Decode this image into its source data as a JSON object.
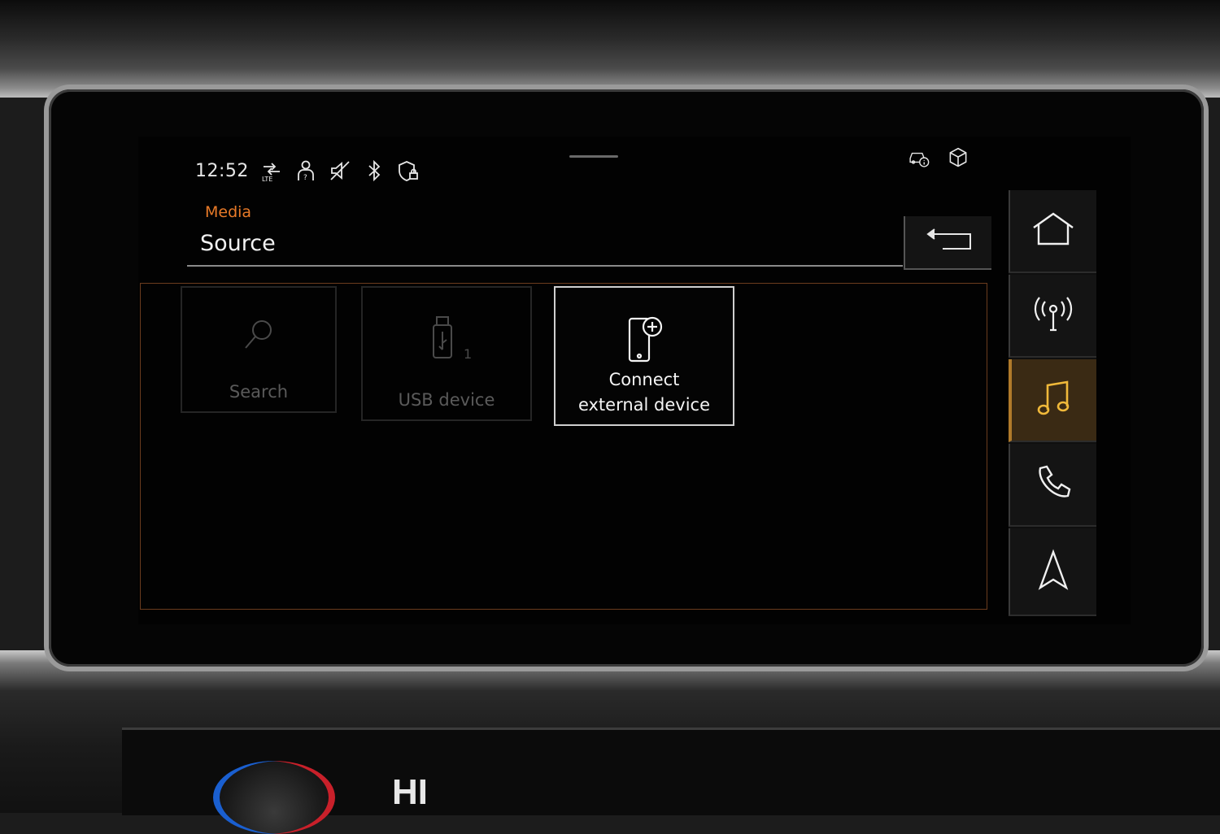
{
  "status_bar": {
    "time": "12:52",
    "icons": [
      "lte-data-icon",
      "profile-icon",
      "mute-icon",
      "bluetooth-icon",
      "privacy-lock-icon"
    ],
    "right_icons": [
      "vehicle-info-icon",
      "package-icon"
    ]
  },
  "header": {
    "breadcrumb": "Media",
    "title": "Source"
  },
  "tiles": [
    {
      "id": "search",
      "label": "Search",
      "icon": "search-icon",
      "enabled": false
    },
    {
      "id": "usb",
      "label": "USB device",
      "icon": "usb-icon",
      "badge": "1",
      "enabled": false
    },
    {
      "id": "connect",
      "label": "Connect external device",
      "label_line1": "Connect",
      "label_line2": "external device",
      "icon": "phone-add-icon",
      "enabled": true
    }
  ],
  "nav": [
    {
      "id": "home",
      "icon": "home-icon",
      "active": false
    },
    {
      "id": "radio",
      "icon": "radio-antenna-icon",
      "active": false
    },
    {
      "id": "media",
      "icon": "music-note-icon",
      "active": true
    },
    {
      "id": "phone",
      "icon": "phone-icon",
      "active": false
    },
    {
      "id": "navigation",
      "icon": "navigation-arrow-icon",
      "active": false
    }
  ],
  "climate": {
    "fan_label": "HI"
  },
  "colors": {
    "accent_orange": "#e87a28",
    "active_nav": "#3a2a14",
    "music_icon": "#f0b93a"
  }
}
